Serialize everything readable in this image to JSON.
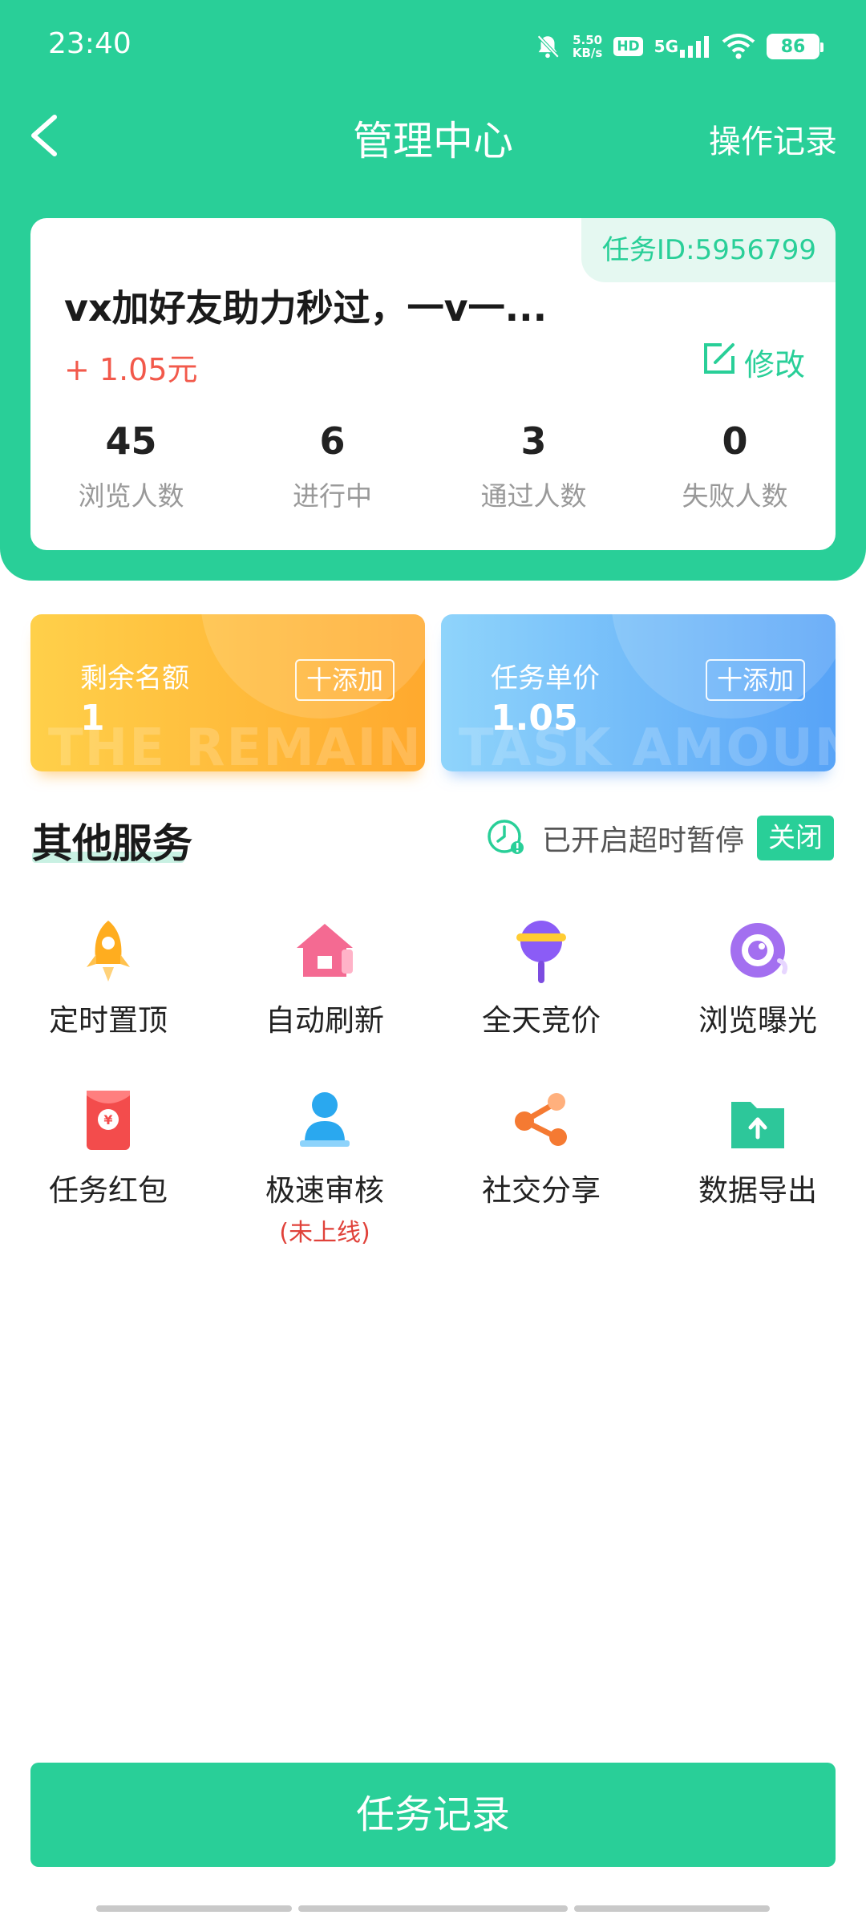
{
  "status_bar": {
    "time": "23:40",
    "net_speed": "5.50",
    "net_unit": "KB/s",
    "hd": "HD",
    "network": "5G",
    "battery": "86"
  },
  "nav": {
    "title": "管理中心",
    "right_label": "操作记录"
  },
  "task": {
    "id_label": "任务ID:5956799",
    "title": "vx加好友助力秒过，一v一...",
    "reward": "+ 1.05元",
    "edit_label": "修改",
    "stats": [
      {
        "value": "45",
        "label": "浏览人数"
      },
      {
        "value": "6",
        "label": "进行中"
      },
      {
        "value": "3",
        "label": "通过人数"
      },
      {
        "value": "0",
        "label": "失败人数"
      }
    ]
  },
  "quota": {
    "remaining_label": "剩余名额",
    "remaining_value": "1",
    "remaining_watermark": "THE REMAIN",
    "price_label": "任务单价",
    "price_value": "1.05",
    "price_watermark": "TASK AMOUNT",
    "add_label": "十添加"
  },
  "services": {
    "title": "其他服务",
    "timeout_text": "已开启超时暂停",
    "toggle_label": "关闭",
    "items": [
      {
        "label": "定时置顶",
        "icon": "rocket-icon",
        "color": "#ffad1f"
      },
      {
        "label": "自动刷新",
        "icon": "house-icon",
        "color": "#f46a92"
      },
      {
        "label": "全天竞价",
        "icon": "lollipop-icon",
        "color": "#8b5cf6"
      },
      {
        "label": "浏览曝光",
        "icon": "eye-icon",
        "color": "#a36ff0"
      },
      {
        "label": "任务红包",
        "icon": "red-envelope-icon",
        "color": "#f34c4c"
      },
      {
        "label": "极速审核",
        "note": "(未上线)",
        "icon": "reviewer-icon",
        "color": "#2aa8ef"
      },
      {
        "label": "社交分享",
        "icon": "share-icon",
        "color": "#f57a32"
      },
      {
        "label": "数据导出",
        "icon": "folder-export-icon",
        "color": "#2dc79a"
      }
    ]
  },
  "bottom": {
    "button_label": "任务记录"
  }
}
